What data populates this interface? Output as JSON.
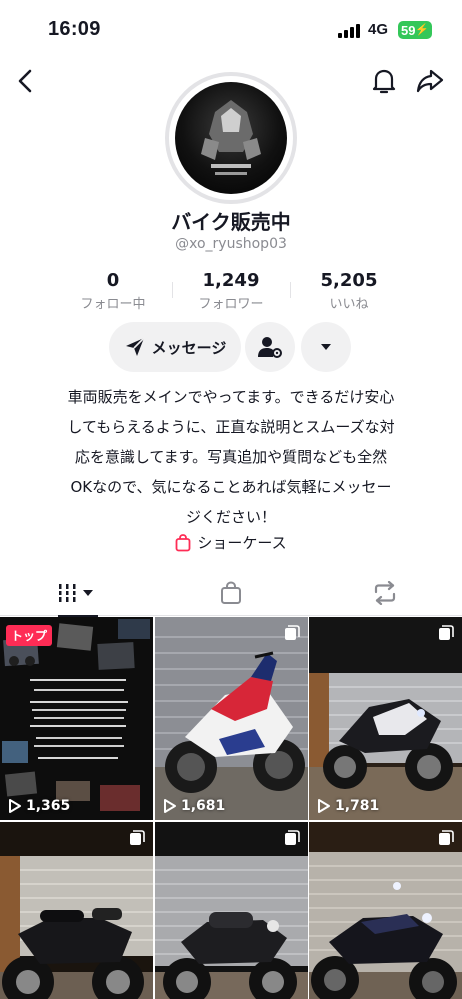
{
  "status_bar": {
    "time": "16:09",
    "network": "4G",
    "battery": "59"
  },
  "profile": {
    "display_name": "バイク販売中",
    "username": "@xo_ryushop03",
    "stats": [
      {
        "value": "0",
        "label": "フォロー中"
      },
      {
        "value": "1,249",
        "label": "フォロワー"
      },
      {
        "value": "5,205",
        "label": "いいね"
      }
    ],
    "message_button": "メッセージ",
    "bio_lines": [
      "車両販売をメインでやってます。できるだけ安心",
      "してもらえるように、正直な説明とスムーズな対",
      "応を意識してます。写真追加や質問なども全然",
      "OKなので、気になることあれば気軽にメッセー",
      "ジください！"
    ],
    "showcase_label": "ショーケース"
  },
  "tabs": [
    {
      "icon": "grid-icon"
    },
    {
      "icon": "shopping-bag-icon"
    },
    {
      "icon": "repost-icon"
    }
  ],
  "videos": [
    {
      "views": "1,365",
      "badge": "トップ"
    },
    {
      "views": "1,681"
    },
    {
      "views": "1,781"
    },
    {
      "views": ""
    },
    {
      "views": ""
    },
    {
      "views": ""
    }
  ],
  "colors": {
    "accent": "#fe2c55",
    "text": "#161823",
    "muted": "#8a8b91",
    "button_bg": "#f1f1f2",
    "battery": "#34c759"
  }
}
